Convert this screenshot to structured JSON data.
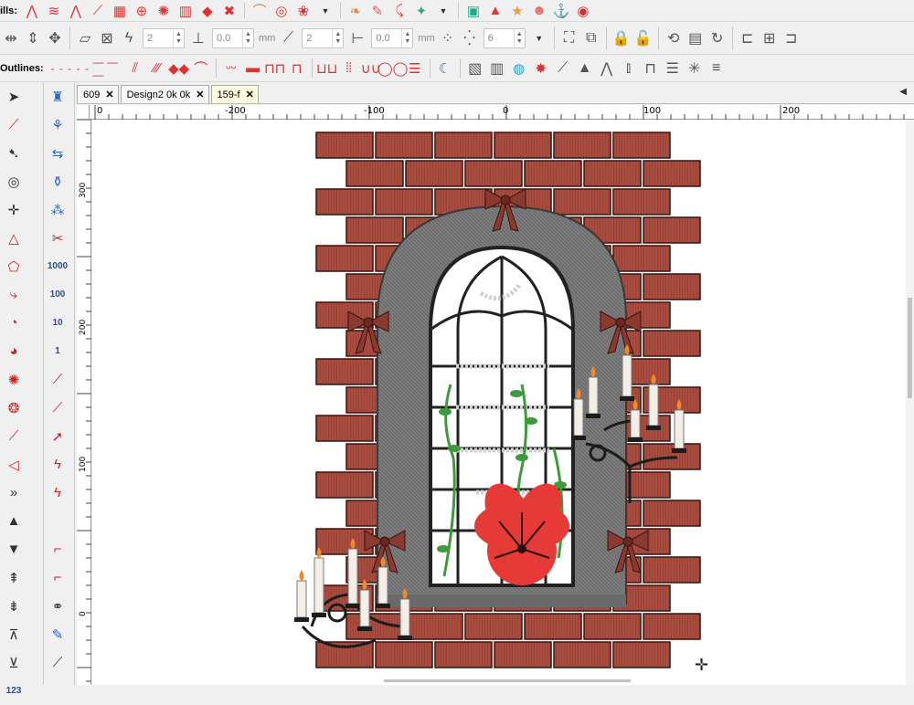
{
  "toolbar_row1": {
    "fills_label": "ills:",
    "icons": [
      "fill-zigzag-icon",
      "fill-chevron-icon",
      "fill-wave-icon",
      "fill-grid-icon",
      "fill-circle-icon",
      "fill-spiral-icon",
      "fill-diamond-icon",
      "fill-cross-icon",
      "fill-arc-icon",
      "fill-swirl-icon",
      "fill-leaf-icon",
      "fill-feather-icon",
      "fill-fish-icon",
      "picture-icon",
      "shapes-icon",
      "star-icon",
      "person-icon",
      "hook-icon"
    ]
  },
  "toolbar_row2": {
    "stepper1": "2",
    "stepper2": "0.0",
    "unit1": "mm",
    "stepper3": "2",
    "stepper4": "0.0",
    "unit2": "mm",
    "stepper5": "6"
  },
  "toolbar_row3": {
    "outlines_label": "Outlines:"
  },
  "tabs": [
    {
      "label": "609",
      "active": false
    },
    {
      "label": "Design2 0k 0k",
      "active": false
    },
    {
      "label": "159-f",
      "active": true
    }
  ],
  "ruler": {
    "h_labels": [
      "0",
      "-200",
      "-100",
      "0",
      "100",
      "200"
    ],
    "v_labels": [
      "300",
      "200",
      "100",
      "0"
    ]
  },
  "left_tools2_numbers": [
    "1000",
    "100",
    "10",
    "1"
  ],
  "left_tools_misc": [
    "123"
  ],
  "colors": {
    "brick": "#a84c3f",
    "mortar": "#3a1410",
    "stone": "#7a7a7a",
    "frame": "#2a2a2a",
    "bow": "#8a3a30",
    "flower": "#e53a35",
    "leaf": "#3e9a3a"
  }
}
